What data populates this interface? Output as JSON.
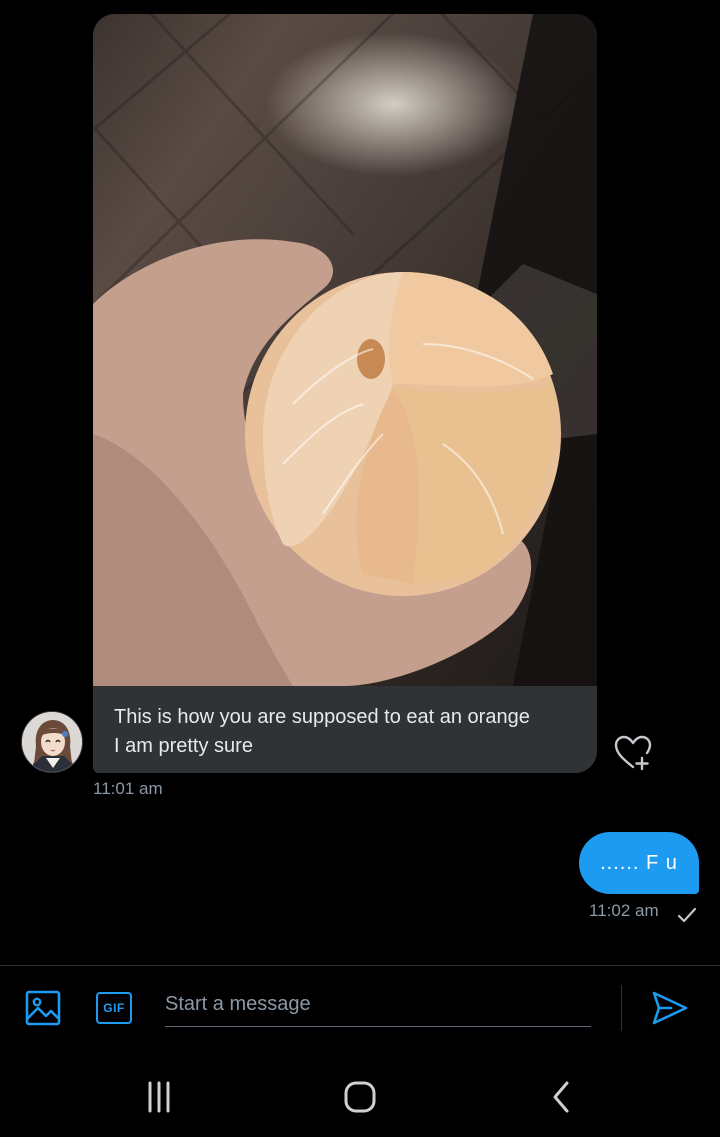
{
  "conversation": {
    "incoming": {
      "caption": "This is how you are supposed to eat an orange\nI am pretty sure",
      "timestamp": "11:01 am",
      "photo_alt": "peeled orange in hand",
      "react_icon": "heart-plus-icon"
    },
    "outgoing": {
      "text": "...... F u",
      "timestamp": "11:02 am",
      "status_icon": "check-icon"
    }
  },
  "composer": {
    "placeholder": "Start a message",
    "image_icon": "image-icon",
    "gif_label": "GIF",
    "send_icon": "send-icon"
  },
  "system_nav": {
    "recents_icon": "recents-icon",
    "home_icon": "home-icon",
    "back_icon": "back-icon"
  },
  "colors": {
    "accent": "#1d9bf0",
    "bubble_incoming": "#2f3336",
    "secondary_text": "#8b98a5",
    "background": "#000000"
  }
}
